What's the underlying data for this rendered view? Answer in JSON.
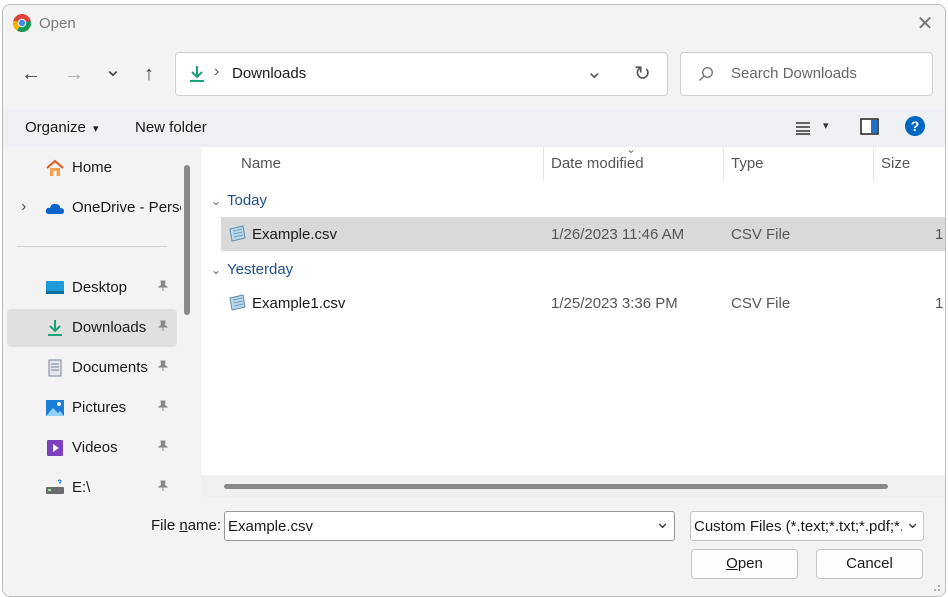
{
  "window": {
    "title": "Open",
    "close_glyph": "✕"
  },
  "nav": {
    "back_glyph": "←",
    "forward_glyph": "→",
    "recent_glyph": "⌄",
    "up_glyph": "↑",
    "breadcrumb_sep": "›",
    "address": "Downloads",
    "address_dropdown_glyph": "⌄",
    "refresh_glyph": "↻",
    "search_placeholder": "Search Downloads"
  },
  "commands": {
    "organize": "Organize",
    "organize_caret": "▾",
    "new_folder": "New folder",
    "view_caret": "▾",
    "help": "?"
  },
  "sidebar": {
    "items": [
      {
        "label": "Home",
        "icon": "home-icon"
      },
      {
        "label": "OneDrive - Perso",
        "icon": "onedrive-icon",
        "expander": "›"
      },
      {
        "label": "Desktop",
        "icon": "desktop-icon"
      },
      {
        "label": "Downloads",
        "icon": "download-icon",
        "selected": true
      },
      {
        "label": "Documents",
        "icon": "documents-icon"
      },
      {
        "label": "Pictures",
        "icon": "pictures-icon"
      },
      {
        "label": "Videos",
        "icon": "videos-icon"
      },
      {
        "label": "E:\\",
        "icon": "drive-icon"
      }
    ],
    "pin_glyph": "📌"
  },
  "list": {
    "columns": {
      "name": "Name",
      "date": "Date modified",
      "type": "Type",
      "size": "Size"
    },
    "sort_glyph": "⌄",
    "groups": [
      {
        "label": "Today",
        "rows": [
          {
            "name": "Example.csv",
            "date": "1/26/2023 11:46 AM",
            "type": "CSV File",
            "size": "1",
            "selected": true
          }
        ]
      },
      {
        "label": "Yesterday",
        "rows": [
          {
            "name": "Example1.csv",
            "date": "1/25/2023 3:36 PM",
            "type": "CSV File",
            "size": "1"
          }
        ]
      }
    ],
    "group_chevron": "⌄"
  },
  "footer": {
    "filename_label_pre": "File ",
    "filename_label_accel": "n",
    "filename_label_post": "ame:",
    "filename_value": "Example.csv",
    "filter_value": "Custom Files (*.text;*.txt;*.pdf;*.c",
    "dropdown_glyph": "⌄",
    "open_accel": "O",
    "open_rest": "pen",
    "cancel": "Cancel"
  },
  "colors": {
    "accent": "#0067c0",
    "group_text": "#1f4f8a",
    "download_green": "#1aa37a"
  }
}
